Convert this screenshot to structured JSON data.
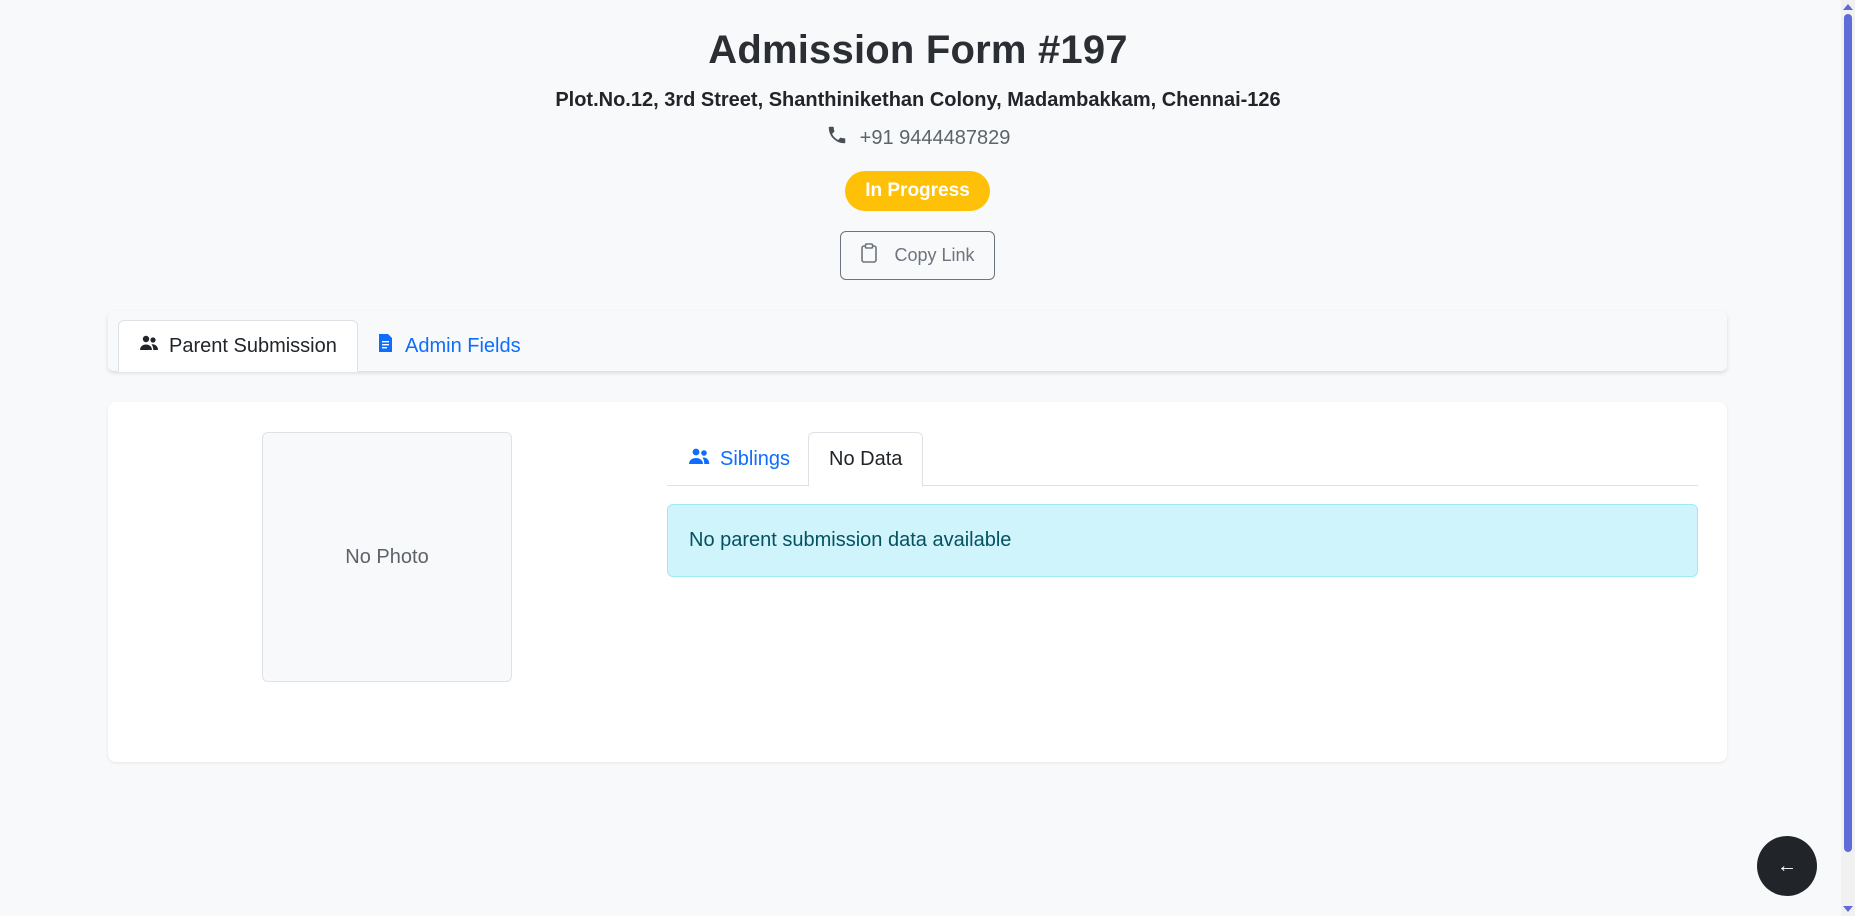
{
  "header": {
    "title": "Admission Form #197",
    "address": "Plot.No.12, 3rd Street, Shanthinikethan Colony, Madambakkam, Chennai-126",
    "phone": "+91 9444487829",
    "status": "In Progress",
    "copy_label": "Copy Link"
  },
  "tabs": {
    "parent_submission": "Parent Submission",
    "admin_fields": "Admin Fields"
  },
  "card": {
    "photo_placeholder": "No Photo",
    "inner_tabs": {
      "siblings": "Siblings",
      "no_data": "No Data"
    },
    "alert": "No parent submission data available"
  },
  "back_button": "←",
  "colors": {
    "status_bg": "#ffc107",
    "link": "#0d6efd",
    "alert_bg": "#cff4fc",
    "alert_text": "#055160",
    "scroll_thumb": "#5f6bd6"
  }
}
